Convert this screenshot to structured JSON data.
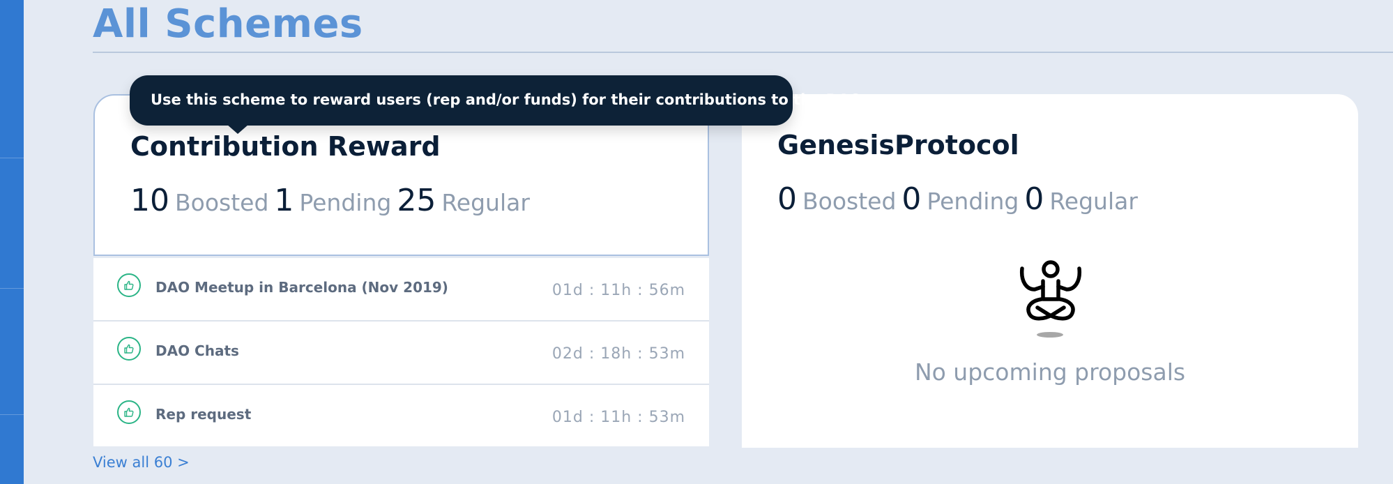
{
  "page": {
    "title": "All Schemes"
  },
  "tooltip": {
    "text": "Use this scheme to reward users (rep and/or funds) for their contributions to the DAO"
  },
  "schemes": [
    {
      "name": "Contribution Reward",
      "boosted_count": "10",
      "boosted_label": "Boosted",
      "pending_count": "1",
      "pending_label": "Pending",
      "regular_count": "25",
      "regular_label": "Regular",
      "proposals": [
        {
          "title": "DAO Meetup in Barcelona (Nov 2019)",
          "timer": "01d : 11h : 56m",
          "icon": "thumbs-up-icon"
        },
        {
          "title": "DAO Chats",
          "timer": "02d : 18h : 53m",
          "icon": "thumbs-up-icon"
        },
        {
          "title": "Rep request",
          "timer": "01d : 11h : 53m",
          "icon": "thumbs-up-icon"
        }
      ],
      "view_all": "View all 60 >"
    },
    {
      "name": "GenesisProtocol",
      "boosted_count": "0",
      "boosted_label": "Boosted",
      "pending_count": "0",
      "pending_label": "Pending",
      "regular_count": "0",
      "regular_label": "Regular",
      "empty_message": "No upcoming proposals",
      "empty_icon": "meditating-person-icon"
    }
  ],
  "colors": {
    "sidebar": "#3079d1",
    "title": "#5b93d6",
    "vote_icon": "#2ab486",
    "tooltip_bg": "#0d2237",
    "link": "#3a7fd3"
  }
}
